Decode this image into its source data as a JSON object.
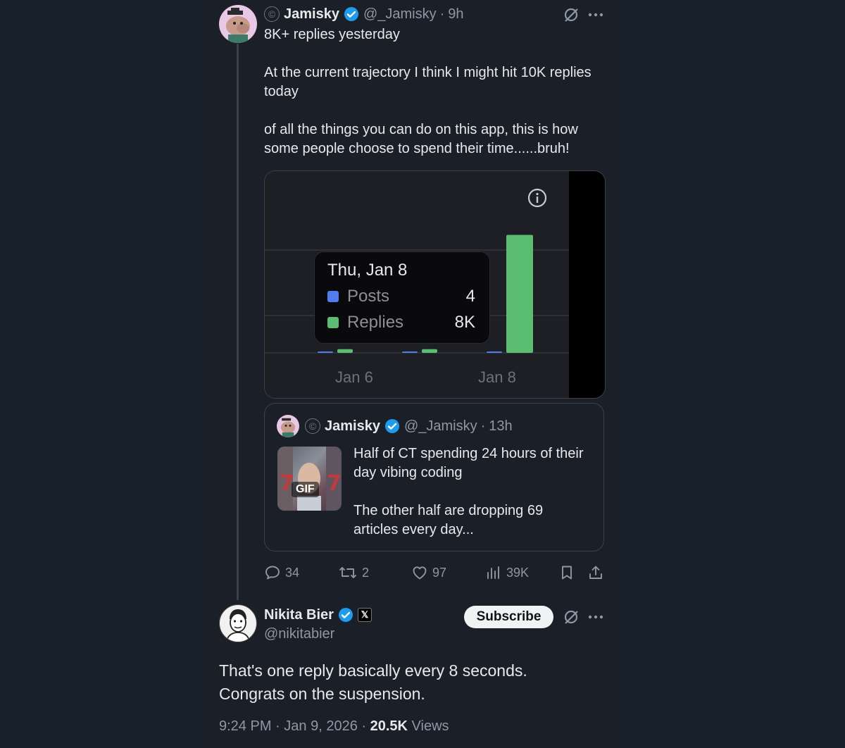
{
  "post": {
    "author_name": "Jamisky",
    "handle": "@_Jamisky",
    "separator": "·",
    "time": "9h",
    "copyright_symbol": "©",
    "paragraphs": [
      "8K+ replies yesterday",
      "At the current trajectory I think I might hit 10K replies today",
      "of all the things you can do on this app, this is how some people choose to spend their time......bruh!"
    ]
  },
  "chart_data": {
    "type": "bar",
    "categories": [
      "Jan 6",
      "",
      "Jan 8"
    ],
    "x_tick_labels": [
      "Jan 6",
      "Jan 8"
    ],
    "series": [
      {
        "name": "Posts",
        "color": "#4f7cf0",
        "values": [
          1,
          1,
          4
        ]
      },
      {
        "name": "Replies",
        "color": "#5bbd72",
        "values": [
          250,
          250,
          8000
        ]
      }
    ],
    "tooltip": {
      "date": "Thu, Jan 8",
      "rows": [
        {
          "label": "Posts",
          "value": "4",
          "color": "#4f7cf0"
        },
        {
          "label": "Replies",
          "value": "8K",
          "color": "#5bbd72"
        }
      ]
    },
    "ylim": [
      0,
      8500
    ],
    "grid": true,
    "background": "#1e1f24"
  },
  "quote": {
    "author_name": "Jamisky",
    "handle": "@_Jamisky",
    "separator": "·",
    "time": "13h",
    "gif_label": "GIF",
    "paragraphs": [
      "Half of CT spending 24 hours of their day vibing coding",
      "The other half are dropping 69 articles every day..."
    ]
  },
  "actions": {
    "replies": "34",
    "reposts": "2",
    "likes": "97",
    "views": "39K"
  },
  "reply": {
    "author_name": "Nikita Bier",
    "handle": "@nikitabier",
    "affiliate_badge": "𝕏",
    "subscribe_label": "Subscribe",
    "text_lines": [
      "That's one reply basically every 8 seconds.",
      "Congrats on the suspension."
    ],
    "meta_time": "9:24 PM",
    "meta_date": "Jan 9, 2026",
    "meta_views_count": "20.5K",
    "meta_views_label": "Views",
    "meta_separator": "·"
  },
  "colors": {
    "verified": "#1d9bf0",
    "background": "#15202b",
    "column": "#1b2028",
    "text": "#e7e9ea",
    "muted": "#8b98a5"
  },
  "icons": {
    "more": "more-icon",
    "grok": "grok-icon",
    "info": "info-icon",
    "reply": "reply-icon",
    "repost": "repost-icon",
    "like": "heart-icon",
    "views": "views-icon",
    "bookmark": "bookmark-icon",
    "share": "share-icon"
  }
}
